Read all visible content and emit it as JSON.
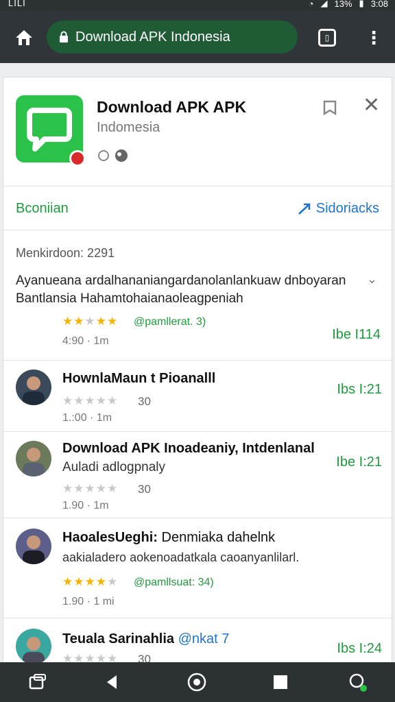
{
  "status": {
    "left": "LILI",
    "battery": "13%",
    "time": "3:08"
  },
  "browser": {
    "url_text": "Download APK Indonesia"
  },
  "app": {
    "title": "Download APK APK",
    "subtitle": "Indomesia"
  },
  "section": {
    "left_label": "Bconiian",
    "right_label": "Sidoriacks"
  },
  "version_text": "Menkirdoon: 2291",
  "description": "Ayanueana ardalhananiangardanolanlankuaw dnboyaran Bantlansia Hahamtohaianaoleagpeniah",
  "first_review": {
    "stars": 4,
    "tag": "@pamllerat. 3)",
    "meta": "4:90 · 1m",
    "right": "Ibe I114"
  },
  "reviews": [
    {
      "name": "HownlaMaun t Pioanalll",
      "sub": "",
      "stars": 0,
      "count": "30",
      "meta": "1.:00 · 1m",
      "right": "Ibs I:21",
      "tag": ""
    },
    {
      "name": "Download APK Inoadeaniy, Intdenlanal",
      "sub": "Auladi adlogpnaly",
      "stars": 0,
      "count": "30",
      "meta": "1.90 · 1m",
      "right": "Ibe I:21",
      "tag": ""
    },
    {
      "name": "HaoalesUeghi:",
      "name_extra": "Denmiaka dahelnk",
      "sub": "aakialadero aokenoadatkala",
      "sub_extra": "caoanyanlilarl.",
      "stars": 4,
      "count": "",
      "meta": "1.90 · 1 mi",
      "right": "",
      "tag": "@pamllsuat: 34)"
    },
    {
      "name": "Teuala Sarinahlia",
      "name_extra": "@nkat 7",
      "sub": "",
      "stars": 0,
      "count": "30",
      "meta": "",
      "right": "Ibs I:24",
      "tag": ""
    }
  ],
  "colors": {
    "accent": "#1f9a3c",
    "link": "#1f74c9",
    "toolbar": "#2f3538",
    "url_pill": "#1f5c35"
  }
}
